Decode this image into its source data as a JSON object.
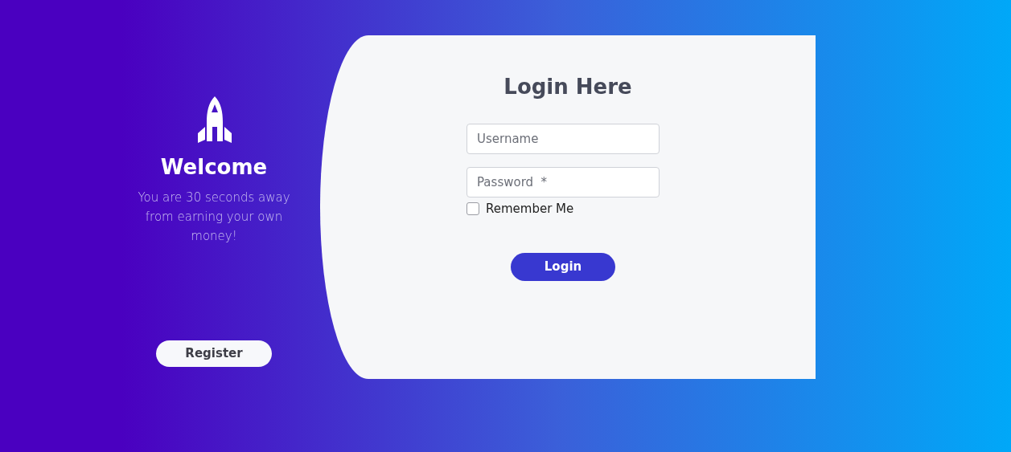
{
  "welcome": {
    "title": "Welcome",
    "message": "You are 30 seconds away from earning your own money!",
    "register_button": "Register"
  },
  "login": {
    "title": "Login Here",
    "fields": [
      {
        "placeholder": "Username"
      },
      {
        "placeholder": "Password  *"
      }
    ],
    "remember": {
      "label": "Remember Me",
      "checked": false
    },
    "submit_button": "Login"
  }
}
